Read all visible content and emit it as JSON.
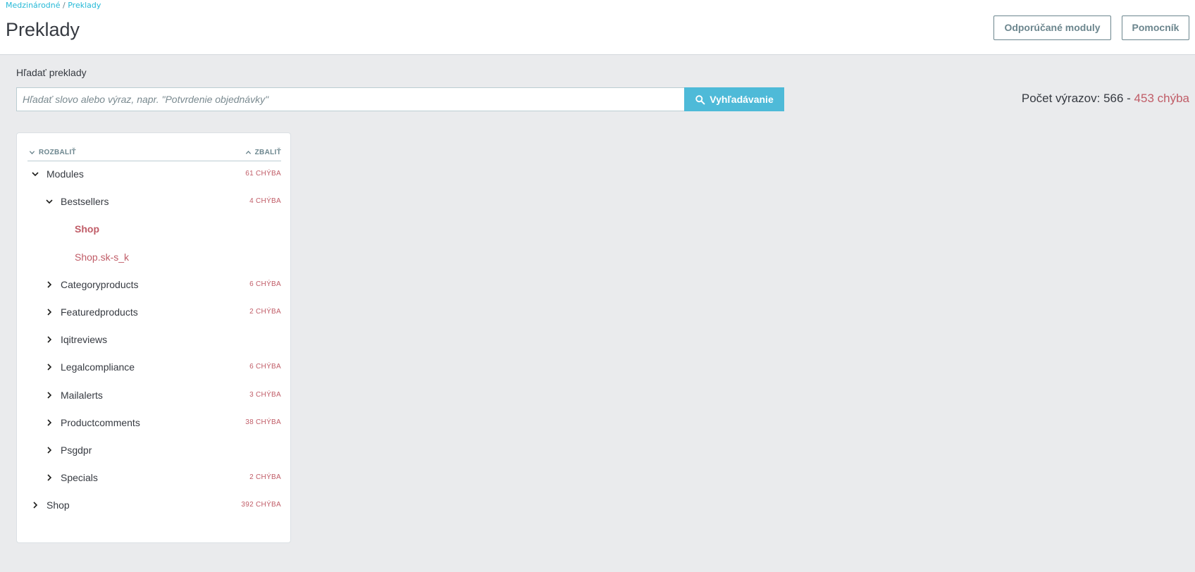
{
  "header": {
    "breadcrumb": [
      "Medzinárodné",
      "Preklady"
    ],
    "title": "Preklady",
    "buttons": {
      "recommended": "Odporúčané moduly",
      "helper": "Pomocník"
    }
  },
  "search": {
    "label": "Hľadať preklady",
    "placeholder": "Hľadať slovo alebo výraz, napr. \"Potvrdenie objednávky\"",
    "button": "Vyhľadávanie"
  },
  "stats": {
    "prefix": "Počet výrazov: 566 - ",
    "missing": "453 chýba"
  },
  "tree": {
    "expand_all": "ROZBALIŤ",
    "collapse_all": "ZBALIŤ",
    "items": [
      {
        "label": "Modules",
        "level": 0,
        "state": "open",
        "missing": "61 CHÝBA"
      },
      {
        "label": "Bestsellers",
        "level": 1,
        "state": "open",
        "missing": "4 CHÝBA"
      },
      {
        "label": "Shop",
        "level": 2,
        "state": "leaf",
        "active": true,
        "missing": ""
      },
      {
        "label": "Shop.sk-s_k",
        "level": 2,
        "state": "leaf",
        "active": false,
        "missing": ""
      },
      {
        "label": "Categoryproducts",
        "level": 1,
        "state": "closed",
        "missing": "6 CHÝBA"
      },
      {
        "label": "Featuredproducts",
        "level": 1,
        "state": "closed",
        "missing": "2 CHÝBA"
      },
      {
        "label": "Iqitreviews",
        "level": 1,
        "state": "closed",
        "missing": ""
      },
      {
        "label": "Legalcompliance",
        "level": 1,
        "state": "closed",
        "missing": "6 CHÝBA"
      },
      {
        "label": "Mailalerts",
        "level": 1,
        "state": "closed",
        "missing": "3 CHÝBA"
      },
      {
        "label": "Productcomments",
        "level": 1,
        "state": "closed",
        "missing": "38 CHÝBA"
      },
      {
        "label": "Psgdpr",
        "level": 1,
        "state": "closed",
        "missing": ""
      },
      {
        "label": "Specials",
        "level": 1,
        "state": "closed",
        "missing": "2 CHÝBA"
      },
      {
        "label": "Shop",
        "level": 0,
        "state": "closed",
        "missing": "392 CHÝBA"
      }
    ]
  },
  "colors": {
    "accent": "#25b9d7",
    "button": "#4ebad8",
    "danger": "#c05c67",
    "text": "#363a41",
    "muted": "#6c868e"
  }
}
